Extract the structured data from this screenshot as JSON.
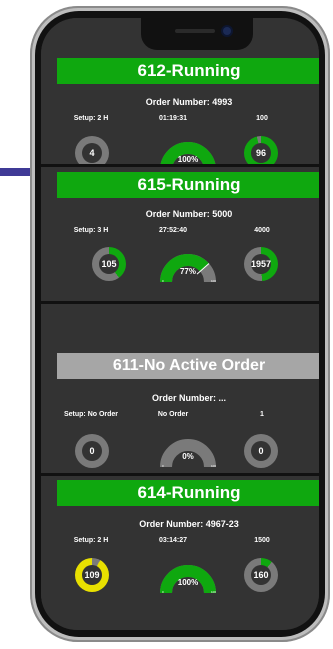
{
  "colors": {
    "running": "#0fa80f",
    "inactive": "#a6a6a6",
    "yellow": "#e8e000",
    "track": "#7a7a7a"
  },
  "cards": [
    {
      "title": "612-Running",
      "status": "running",
      "order": "Order Number: 4993",
      "setup_label": "Setup: 2 H",
      "time_label": "01:19:31",
      "qty_label": "100",
      "setup_value": "4",
      "setup_fraction": 0,
      "setup_color": "#7a7a7a",
      "gauge_text": "100%",
      "gauge_fraction": 1.0,
      "gauge_min": "0",
      "gauge_max": "100",
      "qty_value": "96",
      "qty_fraction": 0.96
    },
    {
      "title": "615-Running",
      "status": "running",
      "order": "Order Number: 5000",
      "setup_label": "Setup: 3 H",
      "time_label": "27:52:40",
      "qty_label": "4000",
      "setup_value": "105",
      "setup_fraction": 0.4,
      "setup_color": "#0fa80f",
      "gauge_text": "77%",
      "gauge_fraction": 0.77,
      "gauge_min": "0",
      "gauge_max": "100",
      "qty_value": "1957",
      "qty_fraction": 0.49
    },
    {
      "title": "611-No Active Order",
      "status": "none",
      "order": "Order Number: ...",
      "setup_label": "Setup: No Order",
      "time_label": "No Order",
      "qty_label": "1",
      "setup_value": "0",
      "setup_fraction": 0,
      "setup_color": "#7a7a7a",
      "gauge_text": "0%",
      "gauge_fraction": 0,
      "gauge_min": "0",
      "gauge_max": "100",
      "qty_value": "0",
      "qty_fraction": 0
    },
    {
      "title": "614-Running",
      "status": "running",
      "order": "Order Number: 4967-23",
      "setup_label": "Setup: 2 H",
      "time_label": "03:14:27",
      "qty_label": "1500",
      "setup_value": "109",
      "setup_fraction": 0.92,
      "setup_color": "#e8e000",
      "gauge_text": "100%",
      "gauge_fraction": 1.0,
      "gauge_min": "0",
      "gauge_max": "100",
      "qty_value": "160",
      "qty_fraction": 0.11
    }
  ]
}
